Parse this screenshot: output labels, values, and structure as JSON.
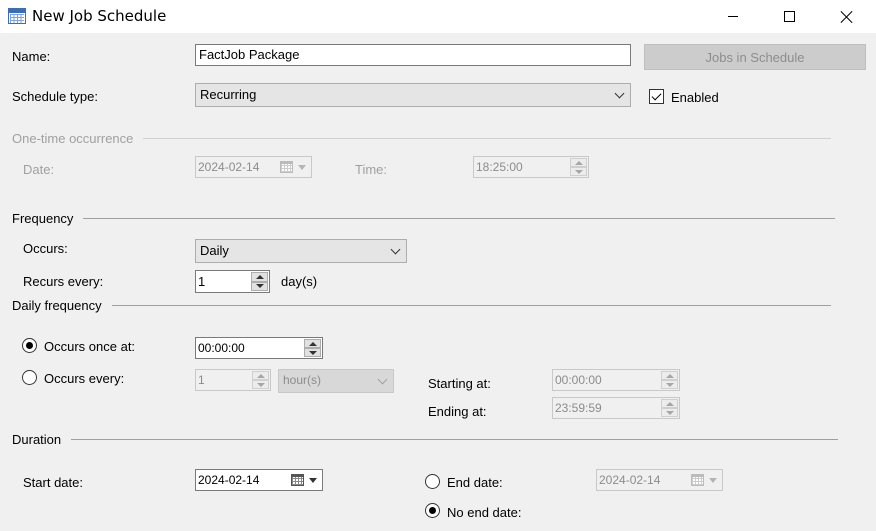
{
  "window": {
    "title": "New Job Schedule"
  },
  "form": {
    "name_label": "Name:",
    "name_value": "FactJob Package",
    "jobs_button": "Jobs in Schedule",
    "schedule_type_label": "Schedule type:",
    "schedule_type_value": "Recurring",
    "enabled_label": "Enabled",
    "enabled_checked": true
  },
  "one_time": {
    "section": "One-time occurrence",
    "date_label": "Date:",
    "date_value": "2024-02-14",
    "time_label": "Time:",
    "time_value": "18:25:00"
  },
  "frequency": {
    "section": "Frequency",
    "occurs_label": "Occurs:",
    "occurs_value": "Daily",
    "recurs_label": "Recurs every:",
    "recurs_value": "1",
    "recurs_unit": "day(s)"
  },
  "daily_frequency": {
    "section": "Daily frequency",
    "once_label": "Occurs once at:",
    "once_value": "00:00:00",
    "every_label": "Occurs every:",
    "every_value": "1",
    "every_unit": "hour(s)",
    "starting_label": "Starting at:",
    "starting_value": "00:00:00",
    "ending_label": "Ending at:",
    "ending_value": "23:59:59",
    "selected": "once"
  },
  "duration": {
    "section": "Duration",
    "start_label": "Start date:",
    "start_value": "2024-02-14",
    "end_label": "End date:",
    "end_value": "2024-02-14",
    "no_end_label": "No end date:",
    "selected": "no_end"
  },
  "icons": [
    "calendar-grid-icon",
    "minimize-icon",
    "maximize-icon",
    "close-icon",
    "chevron-down-icon",
    "calendar-icon",
    "spin-up-icon",
    "spin-down-icon",
    "checkmark-icon"
  ]
}
